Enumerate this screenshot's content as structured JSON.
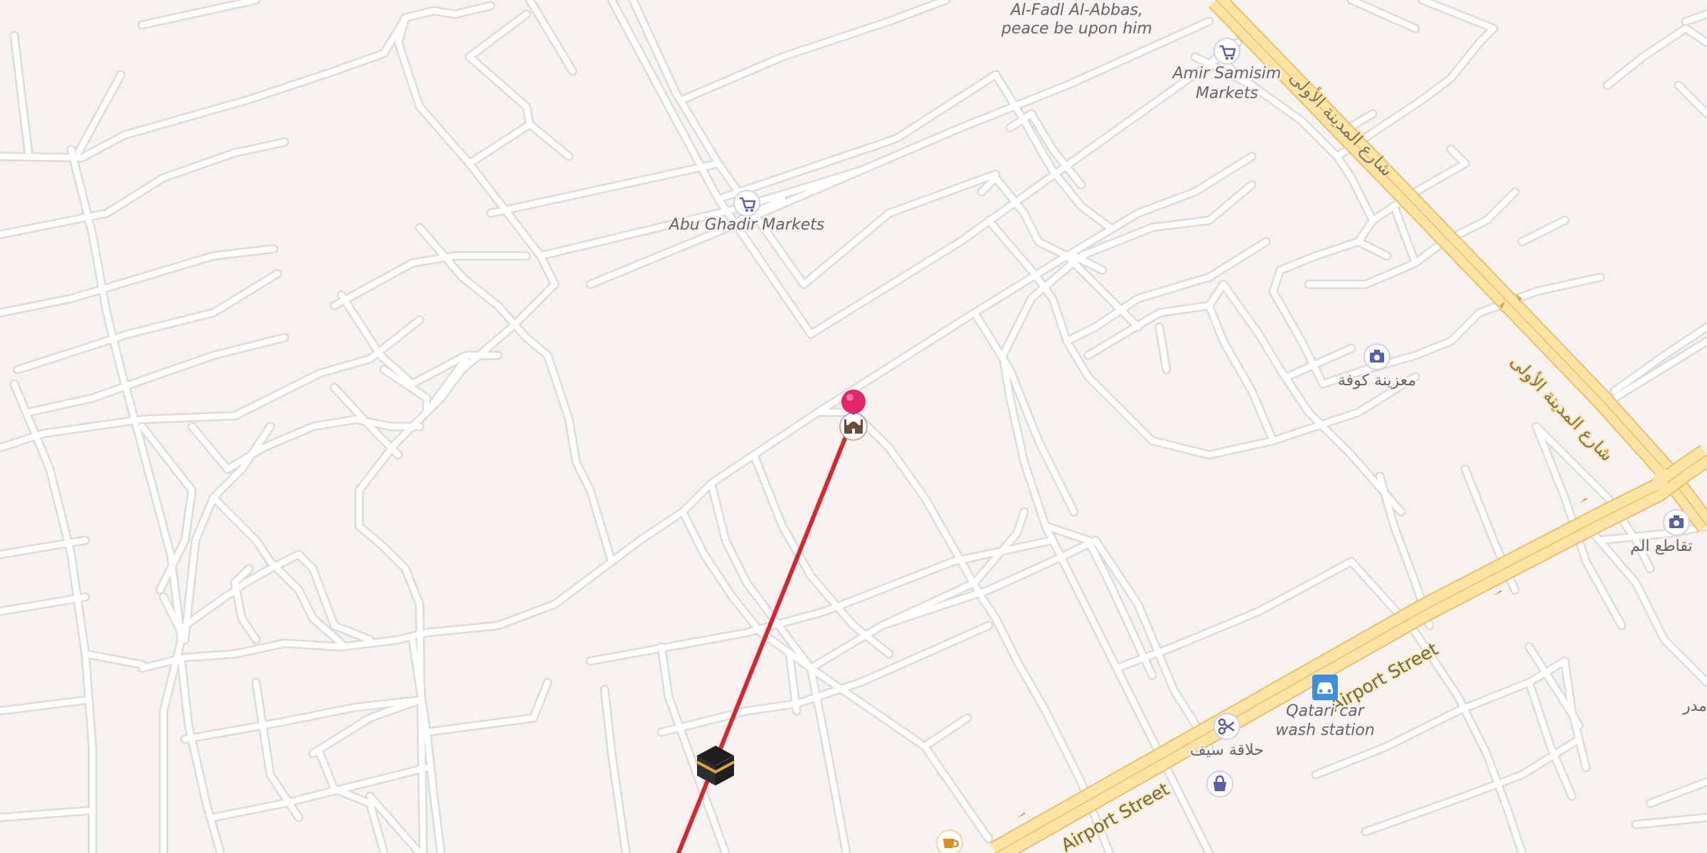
{
  "map": {
    "colors": {
      "background": "#f5f2ef",
      "minor_road": "#ffffff",
      "major_road": "#fbe3a2",
      "major_road_edge": "#e6c06a",
      "route_line": "#d8262e",
      "pin": "#e6246a",
      "poi_icon": "#5a5ea8"
    },
    "pois": {
      "al_fadl": {
        "line1": "Al-Fadl Al-Abbas,",
        "line2": "peace be upon him"
      },
      "amir_samisim": {
        "line1": "Amir Samisim",
        "line2": "Markets",
        "icon": "shopping-cart-icon"
      },
      "abu_ghadir": {
        "label": "Abu Ghadir Markets",
        "icon": "shopping-cart-icon"
      },
      "photo_1": {
        "label": "معزينة كوفة",
        "icon": "camera-icon"
      },
      "photo_2": {
        "label": "تقاطع الم",
        "icon": "camera-icon"
      },
      "car_wash": {
        "line1": "Qatari car",
        "line2": "wash station",
        "icon": "car-icon"
      },
      "barber": {
        "label": "حلاقة سيف",
        "icon": "scissors-icon"
      },
      "school": {
        "label": "مدر"
      },
      "shop": {
        "icon": "shopping-bag-icon"
      },
      "cafe": {
        "icon": "coffee-cup-icon"
      },
      "mosque": {
        "icon": "mosque-icon"
      },
      "kaaba": {
        "icon": "kaaba-icon"
      }
    },
    "streets": {
      "airport_1": "Airport Street",
      "airport_2": "Airport Street",
      "arabic_highway_1": "شارع المدينة الأولى",
      "arabic_highway_2": "شارع المدينة الأولى"
    },
    "markers": {
      "pin": {
        "icon": "location-pin-icon"
      },
      "route": {
        "name": "qibla-direction-line"
      }
    }
  }
}
